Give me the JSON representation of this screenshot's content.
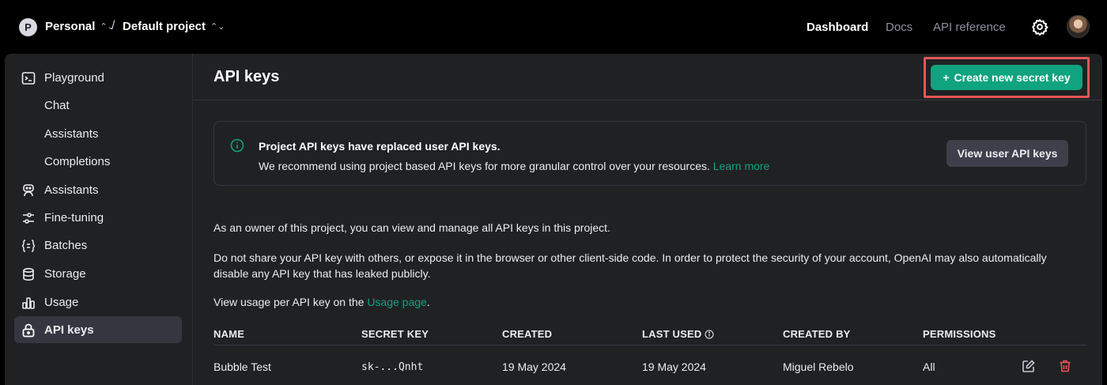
{
  "topbar": {
    "org_initial": "P",
    "org_name": "Personal",
    "project_name": "Default project",
    "separator": "/",
    "nav": {
      "dashboard": "Dashboard",
      "docs": "Docs",
      "api_reference": "API reference"
    }
  },
  "sidebar": {
    "playground": "Playground",
    "chat": "Chat",
    "assistants_sub": "Assistants",
    "completions": "Completions",
    "assistants": "Assistants",
    "fine_tuning": "Fine-tuning",
    "batches": "Batches",
    "storage": "Storage",
    "usage": "Usage",
    "api_keys": "API keys"
  },
  "main": {
    "title": "API keys",
    "create_button": "Create new secret key",
    "create_button_icon": "+",
    "notice": {
      "title": "Project API keys have replaced user API keys.",
      "body": "We recommend using project based API keys for more granular control over your resources.",
      "link": "Learn more",
      "button": "View user API keys"
    },
    "para1": "As an owner of this project, you can view and manage all API keys in this project.",
    "para2": "Do not share your API key with others, or expose it in the browser or other client-side code. In order to protect the security of your account, OpenAI may also automatically disable any API key that has leaked publicly.",
    "para3_prefix": "View usage per API key on the",
    "para3_link": "Usage page",
    "para3_suffix": "."
  },
  "table": {
    "headers": {
      "name": "NAME",
      "secret_key": "SECRET KEY",
      "created": "CREATED",
      "last_used": "LAST USED",
      "created_by": "CREATED BY",
      "permissions": "PERMISSIONS"
    },
    "rows": [
      {
        "name": "Bubble Test",
        "secret_key": "sk-...Qnht",
        "created": "19 May 2024",
        "last_used": "19 May 2024",
        "created_by": "Miguel Rebelo",
        "permissions": "All"
      }
    ]
  },
  "colors": {
    "accent": "#10a37f",
    "danger": "#e25757",
    "background": "#202123",
    "topbar": "#000000"
  }
}
